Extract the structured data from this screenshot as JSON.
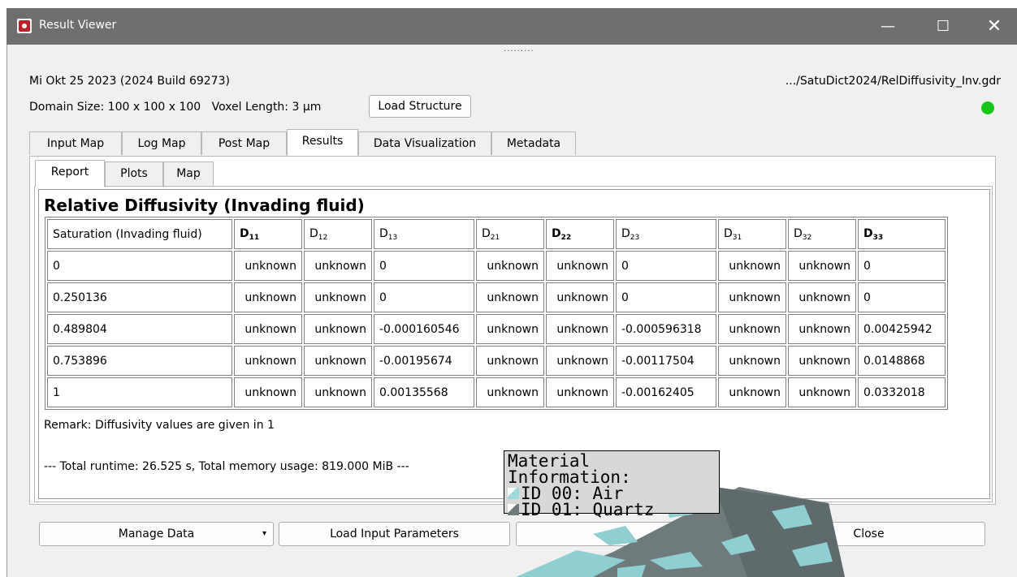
{
  "window": {
    "title": "Result Viewer",
    "controls": {
      "minimize": "—",
      "maximize": "☐",
      "close": "✕"
    }
  },
  "header": {
    "build": "Mi Okt 25 2023 (2024 Build 69273)",
    "path": ".../SatuDict2024/RelDiffusivity_Inv.gdr",
    "domain_size": "Domain Size: 100 x 100 x 100",
    "voxel_length": "Voxel Length: 3 µm",
    "load_structure": "Load Structure",
    "status_color": "#18c718"
  },
  "tabs": [
    "Input Map",
    "Log Map",
    "Post Map",
    "Results",
    "Data Visualization",
    "Metadata"
  ],
  "active_tab": "Results",
  "subtabs": [
    "Report",
    "Plots",
    "Map"
  ],
  "active_subtab": "Report",
  "report": {
    "title": "Relative Diffusivity (Invading fluid)",
    "columns": [
      "Saturation (Invading fluid)",
      "D11",
      "D12",
      "D13",
      "D21",
      "D22",
      "D23",
      "D31",
      "D32",
      "D33"
    ],
    "rows": [
      [
        "0",
        "unknown",
        "unknown",
        "0",
        "unknown",
        "unknown",
        "0",
        "unknown",
        "unknown",
        "0"
      ],
      [
        "0.250136",
        "unknown",
        "unknown",
        "0",
        "unknown",
        "unknown",
        "0",
        "unknown",
        "unknown",
        "0"
      ],
      [
        "0.489804",
        "unknown",
        "unknown",
        "-0.000160546",
        "unknown",
        "unknown",
        "-0.000596318",
        "unknown",
        "unknown",
        "0.00425942"
      ],
      [
        "0.753896",
        "unknown",
        "unknown",
        "-0.00195674",
        "unknown",
        "unknown",
        "-0.00117504",
        "unknown",
        "unknown",
        "0.0148868"
      ],
      [
        "1",
        "unknown",
        "unknown",
        "0.00135568",
        "unknown",
        "unknown",
        "-0.00162405",
        "unknown",
        "unknown",
        "0.0332018"
      ]
    ],
    "remark": "Remark: Diffusivity values are given in 1",
    "runtime": "--- Total runtime: 26.525 s, Total memory usage: 819.000 MiB ---"
  },
  "material_info": {
    "title": "Material Information:",
    "items": [
      {
        "label": "ID 00: Air",
        "color": "#9fd9dc"
      },
      {
        "label": "ID 01: Quartz",
        "color": "#6e7a7c"
      }
    ]
  },
  "buttons": {
    "manage_data": "Manage Data",
    "load_input_parameters": "Load Input Parameters",
    "close": "Close"
  }
}
